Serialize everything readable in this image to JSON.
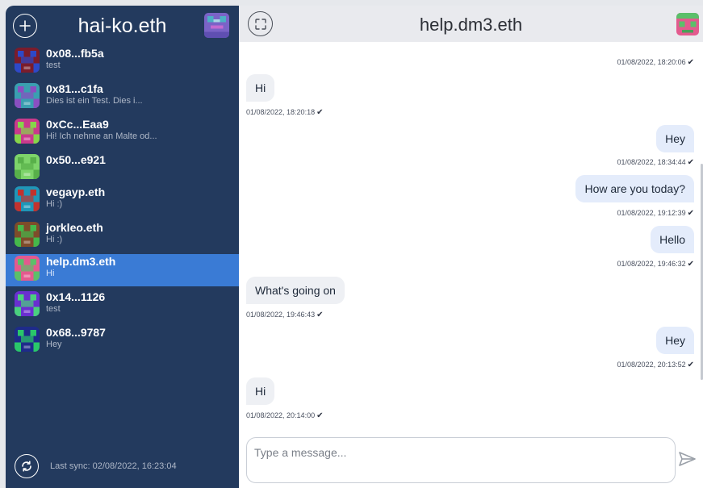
{
  "sidebar": {
    "title": "hai-ko.eth",
    "contacts": [
      {
        "name": "0x08...fb5a",
        "preview": "test",
        "colors": [
          "#7a1c2c",
          "#2e49c8"
        ]
      },
      {
        "name": "0x81...c1fa",
        "preview": "Dies ist ein Test. Dies i...",
        "colors": [
          "#3a9fb0",
          "#8a4fc0"
        ]
      },
      {
        "name": "0xCc...Eaa9",
        "preview": "Hi! Ich nehme an Malte od...",
        "colors": [
          "#c93a8c",
          "#86d64a"
        ]
      },
      {
        "name": "0x50...e921",
        "preview": "",
        "colors": [
          "#7dd46a",
          "#58b04a"
        ]
      },
      {
        "name": "vegayp.eth",
        "preview": "Hi :)",
        "colors": [
          "#1f96b8",
          "#c2322e"
        ]
      },
      {
        "name": "jorkleo.eth",
        "preview": "Hi :)",
        "colors": [
          "#7e4c2a",
          "#45b84b"
        ]
      },
      {
        "name": "help.dm3.eth",
        "preview": "Hi",
        "colors": [
          "#e35a8e",
          "#5bbf6a"
        ]
      },
      {
        "name": "0x14...1126",
        "preview": "test",
        "colors": [
          "#6a2fd0",
          "#4ad07e"
        ]
      },
      {
        "name": "0x68...9787",
        "preview": "Hey",
        "colors": [
          "#1e2b8a",
          "#2ac76a"
        ]
      }
    ],
    "last_sync": "Last sync: 02/08/2022, 16:23:04"
  },
  "chat": {
    "title": "help.dm3.eth",
    "messages": [
      {
        "text": "",
        "time": "01/08/2022, 18:20:06",
        "side": "sent"
      },
      {
        "text": "Hi",
        "time": "01/08/2022, 18:20:18",
        "side": "recv"
      },
      {
        "text": "Hey",
        "time": "01/08/2022, 18:34:44",
        "side": "sent"
      },
      {
        "text": "How are you today?",
        "time": "01/08/2022, 19:12:39",
        "side": "sent"
      },
      {
        "text": "Hello",
        "time": "01/08/2022, 19:46:32",
        "side": "sent"
      },
      {
        "text": "What's going on",
        "time": "01/08/2022, 19:46:43",
        "side": "recv"
      },
      {
        "text": "Hey",
        "time": "01/08/2022, 20:13:52",
        "side": "sent"
      },
      {
        "text": "Hi",
        "time": "01/08/2022, 20:14:00",
        "side": "recv"
      }
    ],
    "composer_placeholder": "Type a message..."
  },
  "icons": {
    "add": "plus-circle-icon",
    "refresh": "refresh-circle-icon",
    "expand": "expand-icon",
    "send": "send-icon",
    "tick": "check-icon"
  },
  "colors": {
    "sidebar_bg": "#233a5e",
    "selected": "#3a7bd5",
    "bubble_sent": "#e4ecfb",
    "bubble_recv": "#eef0f4"
  }
}
